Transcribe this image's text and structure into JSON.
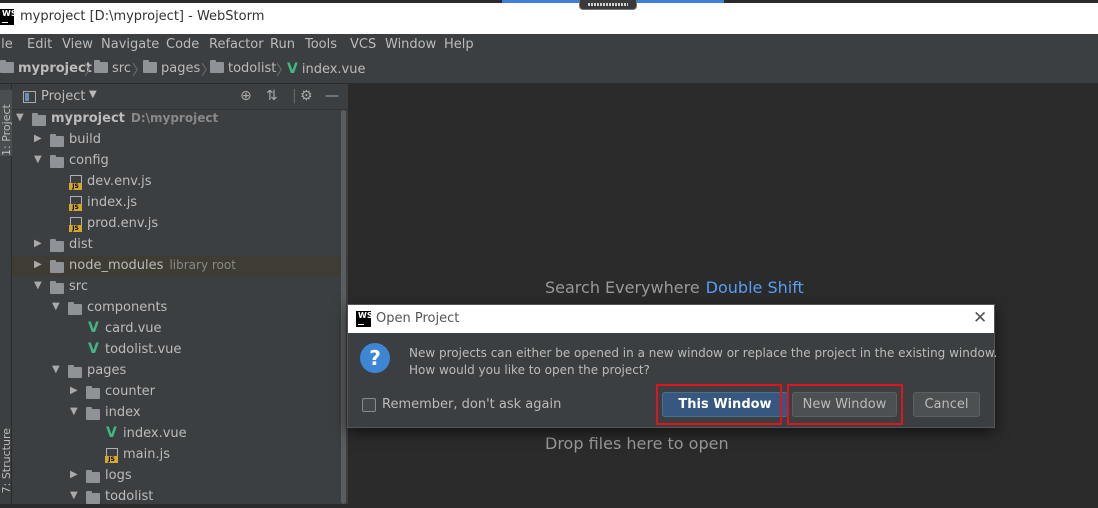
{
  "window": {
    "title": "myproject [D:\\myproject] - WebStorm",
    "app_icon": "WS"
  },
  "menu": [
    "File",
    "Edit",
    "View",
    "Navigate",
    "Code",
    "Refactor",
    "Run",
    "Tools",
    "VCS",
    "Window",
    "Help"
  ],
  "breadcrumb": [
    "myproject",
    "src",
    "pages",
    "todolist",
    "index.vue"
  ],
  "tool_windows": {
    "project_tab": "1: Project",
    "structure_tab": "7: Structure"
  },
  "project_panel": {
    "title": "Project",
    "tree": [
      {
        "label": "myproject",
        "detail": "D:\\myproject",
        "type": "folder",
        "expanded": true
      },
      {
        "label": "build",
        "type": "folder",
        "expanded": false
      },
      {
        "label": "config",
        "type": "folder",
        "expanded": true
      },
      {
        "label": "dev.env.js",
        "type": "js"
      },
      {
        "label": "index.js",
        "type": "js"
      },
      {
        "label": "prod.env.js",
        "type": "js"
      },
      {
        "label": "dist",
        "type": "folder",
        "expanded": false
      },
      {
        "label": "node_modules",
        "detail": "library root",
        "type": "folder",
        "expanded": false
      },
      {
        "label": "src",
        "type": "folder",
        "expanded": true
      },
      {
        "label": "components",
        "type": "folder",
        "expanded": true
      },
      {
        "label": "card.vue",
        "type": "vue"
      },
      {
        "label": "todolist.vue",
        "type": "vue"
      },
      {
        "label": "pages",
        "type": "folder",
        "expanded": true
      },
      {
        "label": "counter",
        "type": "folder",
        "expanded": false
      },
      {
        "label": "index",
        "type": "folder",
        "expanded": true
      },
      {
        "label": "index.vue",
        "type": "vue"
      },
      {
        "label": "main.js",
        "type": "js"
      },
      {
        "label": "logs",
        "type": "folder",
        "expanded": false
      },
      {
        "label": "todolist",
        "type": "folder",
        "expanded": true
      }
    ]
  },
  "editor": {
    "search_hint": "Search Everywhere",
    "search_key": "Double Shift",
    "drop_hint": "Drop files here to open"
  },
  "dialog": {
    "title": "Open Project",
    "message_line1": "New projects can either be opened in a new window or replace the project in the existing window.",
    "message_line2": "How would you like to open the project?",
    "checkbox_label": "Remember, don't ask again",
    "checkbox_checked": false,
    "this_window": "This Window",
    "new_window": "New Window",
    "cancel": "Cancel"
  },
  "colors": {
    "accent": "#589df6",
    "primary_button": "#365880",
    "highlight_box": "#e0141e",
    "vue": "#41b883"
  }
}
